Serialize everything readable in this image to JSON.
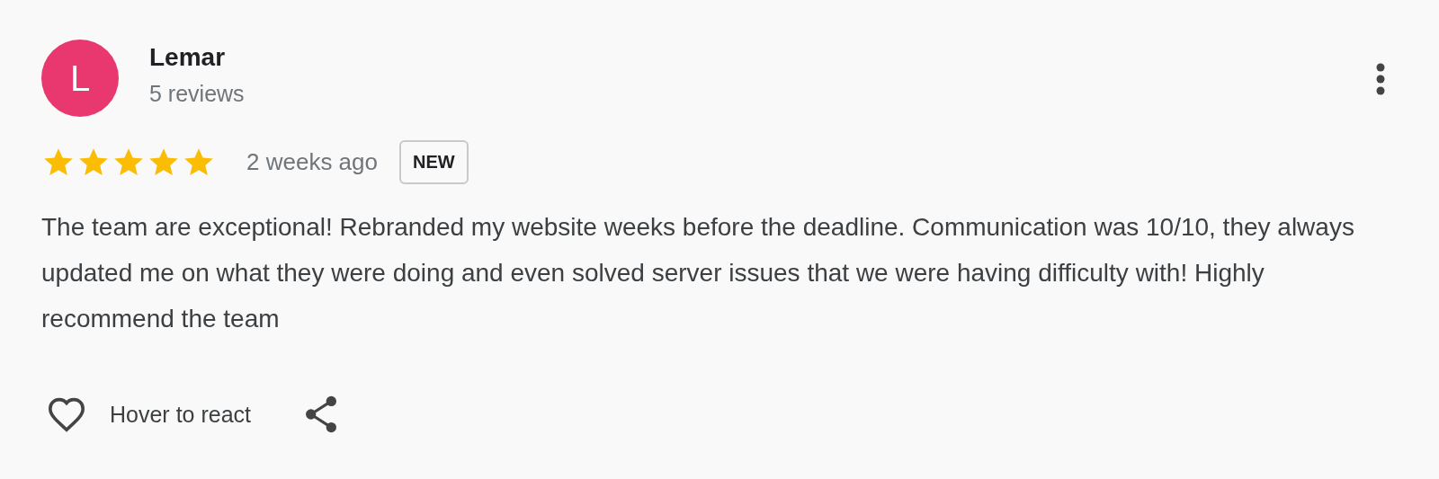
{
  "review": {
    "avatar_letter": "L",
    "author": "Lemar",
    "review_count": "5 reviews",
    "stars": 5,
    "time": "2 weeks ago",
    "badge": "NEW",
    "text": "The team are exceptional! Rebranded my website weeks before the deadline. Communication was 10/10, they always updated me on what they were doing and even solved server issues that we were having difficulty with! Highly recommend the team"
  },
  "actions": {
    "react_label": "Hover to react"
  }
}
